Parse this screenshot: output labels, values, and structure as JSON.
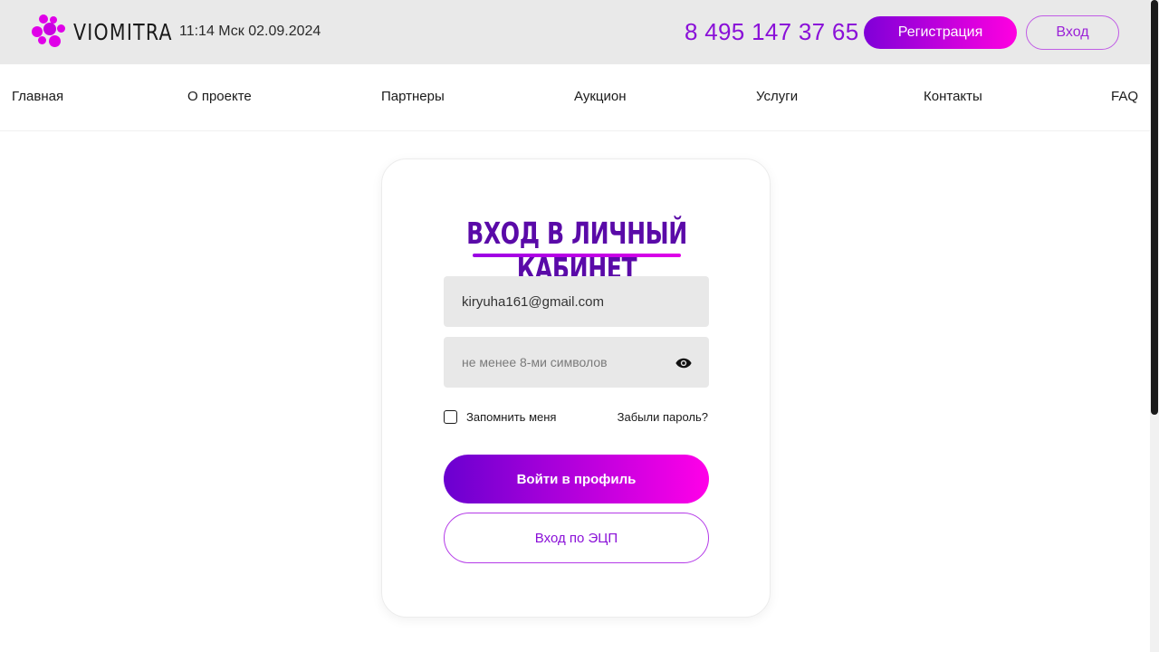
{
  "header": {
    "logo_text": "VIOMITRA",
    "datetime": "11:14 Мск 02.09.2024",
    "phone": "8 495 147 37 65",
    "register_label": "Регистрация",
    "login_label": "Вход"
  },
  "nav": {
    "items": [
      {
        "label": "Главная"
      },
      {
        "label": "О проекте"
      },
      {
        "label": "Партнеры"
      },
      {
        "label": "Аукцион"
      },
      {
        "label": "Услуги"
      },
      {
        "label": "Контакты"
      },
      {
        "label": "FAQ"
      }
    ]
  },
  "login_form": {
    "title": "Вход в личный кабинет",
    "email_value": "kiryuha161@gmail.com",
    "password_value": "",
    "password_placeholder": "не менее 8-ми символов",
    "remember_label": "Запомнить меня",
    "remember_checked": false,
    "forgot_label": "Забыли пароль?",
    "submit_label": "Войти в профиль",
    "ecp_label": "Вход по ЭЦП"
  },
  "colors": {
    "brand_purple": "#8a10d8",
    "brand_magenta": "#ff00e8",
    "title_purple": "#5a0aa8",
    "topbar_bg": "#e9e9e9",
    "field_bg": "#e8e8e8"
  },
  "icons": {
    "logo": "molecule-logo-icon",
    "password_toggle": "eye-icon",
    "remember": "checkbox-icon"
  }
}
